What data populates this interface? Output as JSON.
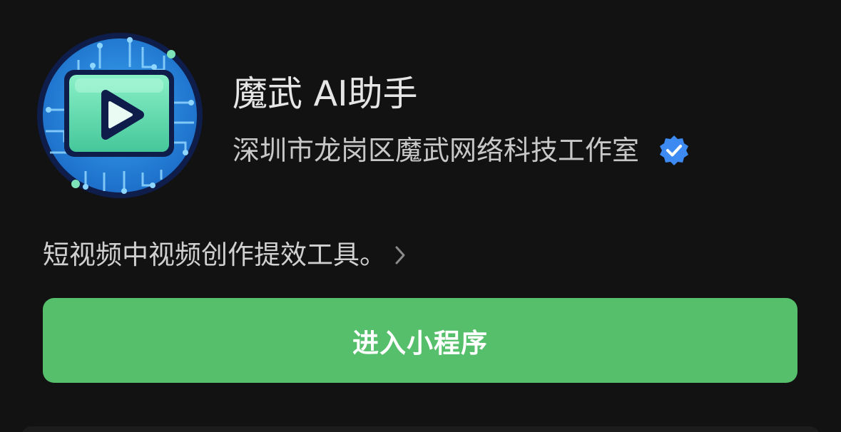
{
  "app": {
    "name": "魔武 AI助手",
    "developer": "深圳市龙岗区魔武网络科技工作室",
    "description": "短视频中视频创作提效工具。",
    "logo_icon": "play-button-circuit-logo",
    "verified_icon": "verified-badge-icon"
  },
  "actions": {
    "enter_label": "进入小程序"
  },
  "colors": {
    "background": "#121212",
    "primary_button": "#56bf6c",
    "verified_badge": "#3d8bf2",
    "logo_ring": "#0e1d4a",
    "logo_disc": "#2f8fe0",
    "logo_screen": "#5fd9a8"
  }
}
